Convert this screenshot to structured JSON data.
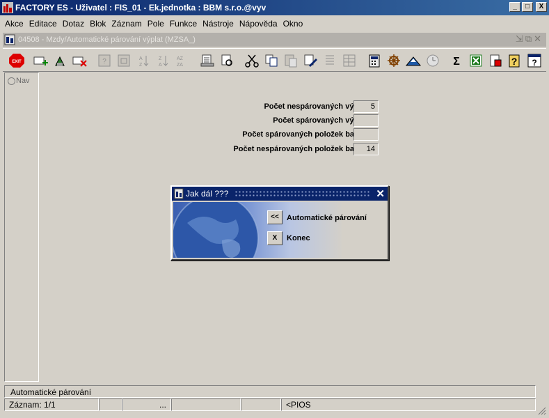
{
  "window": {
    "title": "FACTORY ES - Uživatel : FIS_01 - Ek.jednotka : BBM s.r.o.@vyv",
    "minimize": "_",
    "maximize": "□",
    "close": "X"
  },
  "menu": [
    "Akce",
    "Editace",
    "Dotaz",
    "Blok",
    "Záznam",
    "Pole",
    "Funkce",
    "Nástroje",
    "Nápověda",
    "Okno"
  ],
  "inner_window": {
    "title": "04508 - Mzdy/Automatické párování výplat (MZSA_)",
    "controls": "⇲⧉✕"
  },
  "nav": {
    "label": "Nav"
  },
  "form": {
    "rows": [
      {
        "label": "Počet nespárovaných výplat",
        "value": "5"
      },
      {
        "label": "Počet spárovaných výplat",
        "value": ""
      },
      {
        "label": "Počet spárovaných položek banky",
        "value": ""
      },
      {
        "label": "Počet nespárovaných položek banky",
        "value": "14"
      }
    ]
  },
  "dialog": {
    "title": "Jak dál ???",
    "close": "✕",
    "options": [
      {
        "button": "<<",
        "label": "Automatické párování"
      },
      {
        "button": "X",
        "label": "Konec"
      }
    ]
  },
  "status": {
    "message": "Automatické párování",
    "record": "Záznam: 1/1",
    "ellipsis": "...",
    "mode": "<PIOS"
  },
  "colors": {
    "titlebar": "#0a246a",
    "background": "#d4d0c8"
  }
}
